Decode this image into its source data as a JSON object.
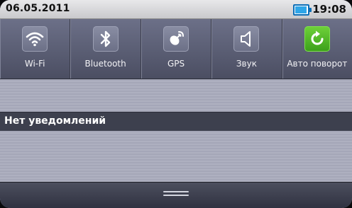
{
  "status": {
    "date": "06.05.2011",
    "time": "19:08",
    "battery_level": 0.85
  },
  "toggles": [
    {
      "label": "Wi-Fi",
      "icon": "wifi-icon",
      "active": false
    },
    {
      "label": "Bluetooth",
      "icon": "bluetooth-icon",
      "active": false
    },
    {
      "label": "GPS",
      "icon": "gps-icon",
      "active": false
    },
    {
      "label": "Звук",
      "icon": "speaker-icon",
      "active": false
    },
    {
      "label": "Авто поворот",
      "icon": "auto-rotate-icon",
      "active": true
    }
  ],
  "notifications": {
    "header": "Нет уведомлений"
  },
  "colors": {
    "active_toggle": "#4fb526",
    "battery": "#2fa6e8"
  }
}
